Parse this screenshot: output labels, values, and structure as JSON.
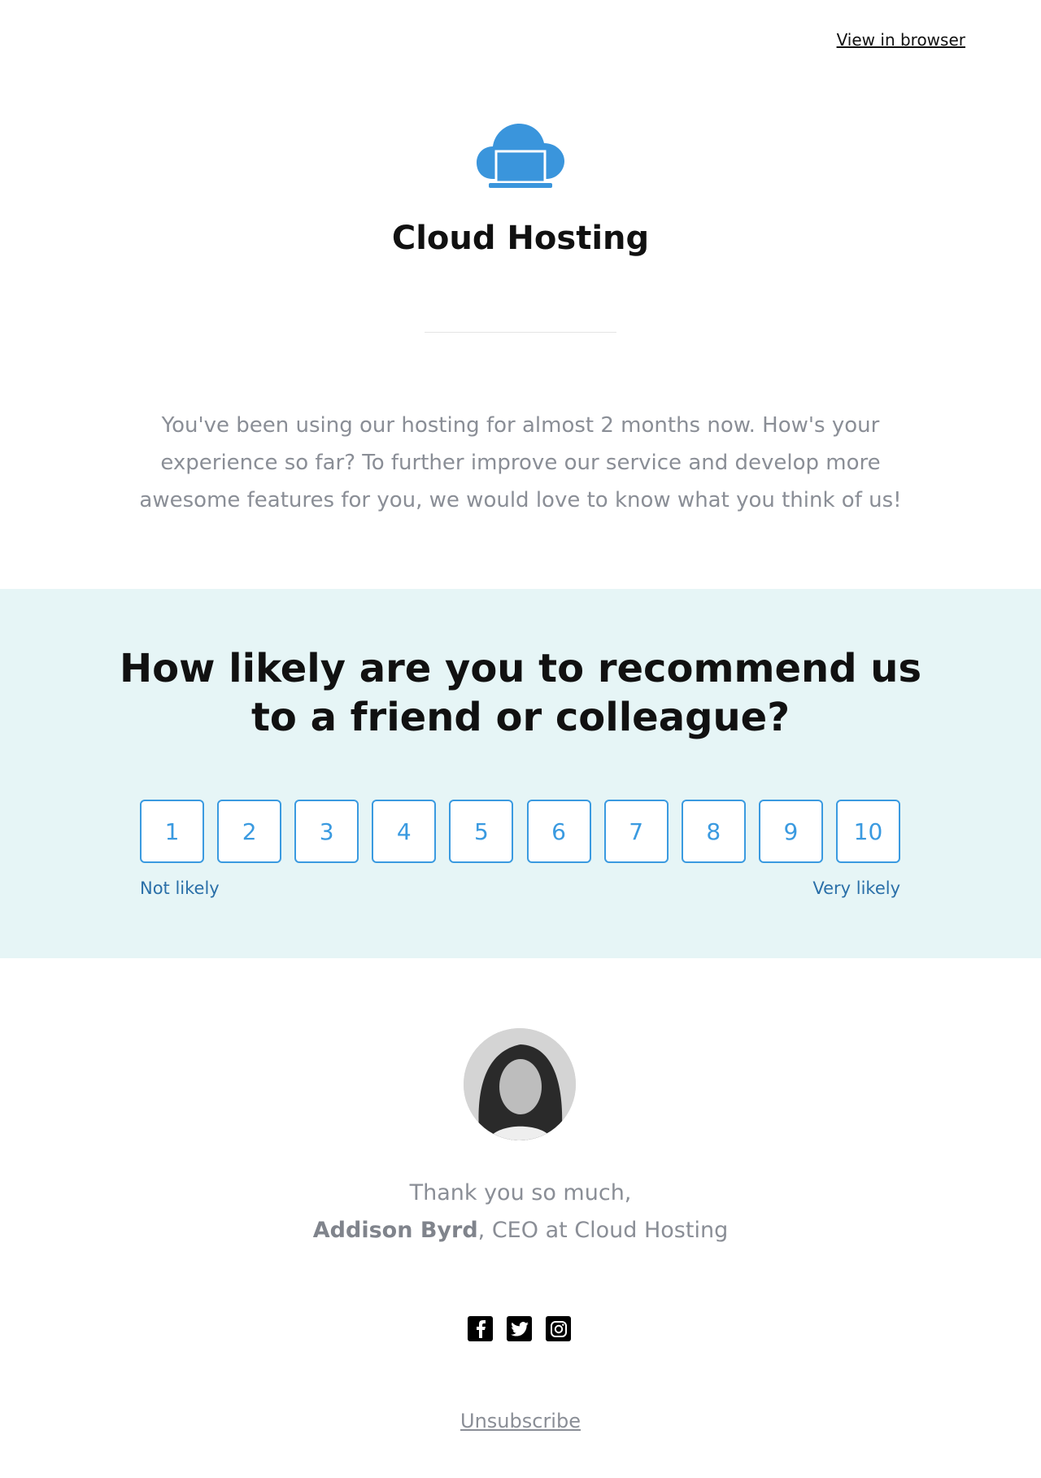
{
  "header": {
    "view_in_browser": "View in browser"
  },
  "brand": {
    "name": "Cloud Hosting",
    "logo_icon": "cloud-laptop-icon",
    "accent": "#3a9ae0"
  },
  "intro": "You've been using our hosting for almost 2 months now. How's your experience so far? To further improve our service and develop more awesome features for you, we would love to know what you think of us!",
  "survey": {
    "question_line1": "How likely are you to recommend us",
    "question_line2": "to a friend or colleague?",
    "options": [
      "1",
      "2",
      "3",
      "4",
      "5",
      "6",
      "7",
      "8",
      "9",
      "10"
    ],
    "low_label": "Not likely",
    "high_label": "Very likely",
    "background": "#e6f5f6"
  },
  "signature": {
    "thanks": "Thank you so much,",
    "name": "Addison Byrd",
    "role": ", CEO at Cloud Hosting"
  },
  "social": [
    "facebook-icon",
    "twitter-icon",
    "instagram-icon"
  ],
  "footer": {
    "unsubscribe": "Unsubscribe"
  }
}
